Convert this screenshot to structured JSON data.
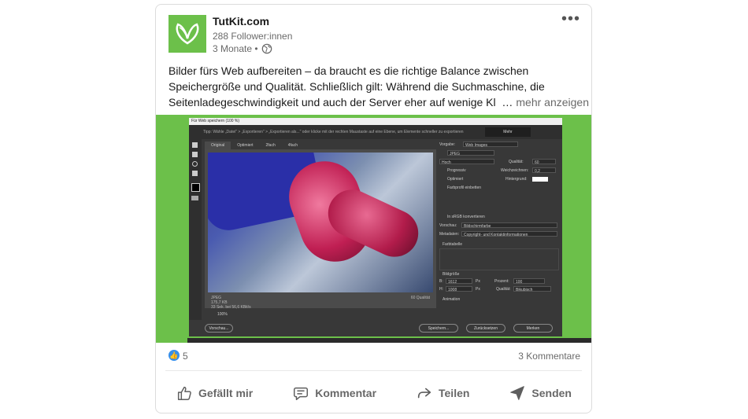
{
  "post": {
    "author": "TutKit.com",
    "followers": "288 Follower:innen",
    "age": "3 Monate •",
    "text_lines": [
      "Bilder fürs Web aufbereiten – da braucht es die richtige Balance zwischen",
      "Speichergröße und Qualität. Schließlich gilt: Während die Suchmaschine, die",
      "Seitenladegeschwindigkeit und auch der Server eher auf wenige Kl"
    ],
    "ellipsis": "…",
    "see_more": "mehr anzeigen",
    "more_icon": "•••"
  },
  "screenshot": {
    "window_title": "Für Web speichern (100 %)",
    "info_text": "Tipp: Wähle „Datei\" > „Exportieren\" > „Exportieren als...\" oder klicke mit der rechten Maustaste auf eine Ebene, um Elemente schneller zu exportieren",
    "help_button": "Mehr",
    "tabs": [
      "Original",
      "Optimiert",
      "2fach",
      "4fach"
    ],
    "image_meta": [
      "JPEG",
      "175,7 KB",
      "33 Sek. bei 56,6 KBit/s"
    ],
    "quality_note": "60 Qualität",
    "preset_label": "Vorgabe:",
    "preset_value": "Web Images",
    "format": "JPEG",
    "compression": "Hoch",
    "quality_label": "Qualität:",
    "quality_value": "60",
    "blur_label": "Weichzeichnen:",
    "blur_value": "0,2",
    "matte_label": "Hintergrund:",
    "progressive": "Progressiv",
    "optimized": "Optimiert",
    "embed_profile": "Farbprofil einbetten",
    "convert_srgb": "In sRGB konvertieren",
    "preview_label": "Vorschau:",
    "preview_value": "Bildschirmfarbe",
    "metadata_label": "Metadaten:",
    "metadata_value": "Copyright- und Kontaktinformationen",
    "color_table": "Farbtabelle",
    "image_size": "Bildgröße",
    "width_label": "B:",
    "width_value": "1612",
    "height_label": "H:",
    "height_value": "1008",
    "unit_px": "Px",
    "percent_label": "Prozent:",
    "percent_value": "100",
    "resample_label": "Qualität:",
    "resample_value": "Bikubisch",
    "animation": "Animation",
    "zoom": "100%",
    "preview_btn": "Vorschau...",
    "save_btn": "Speichern...",
    "reset_btn": "Zurücksetzen",
    "remember_btn": "Merken"
  },
  "social": {
    "like_count": "5",
    "comments": "3 Kommentare",
    "actions": [
      "Gefällt mir",
      "Kommentar",
      "Teilen",
      "Senden"
    ]
  },
  "colors": {
    "brand_green": "#6cc04a",
    "like_blue": "#378fe9"
  }
}
